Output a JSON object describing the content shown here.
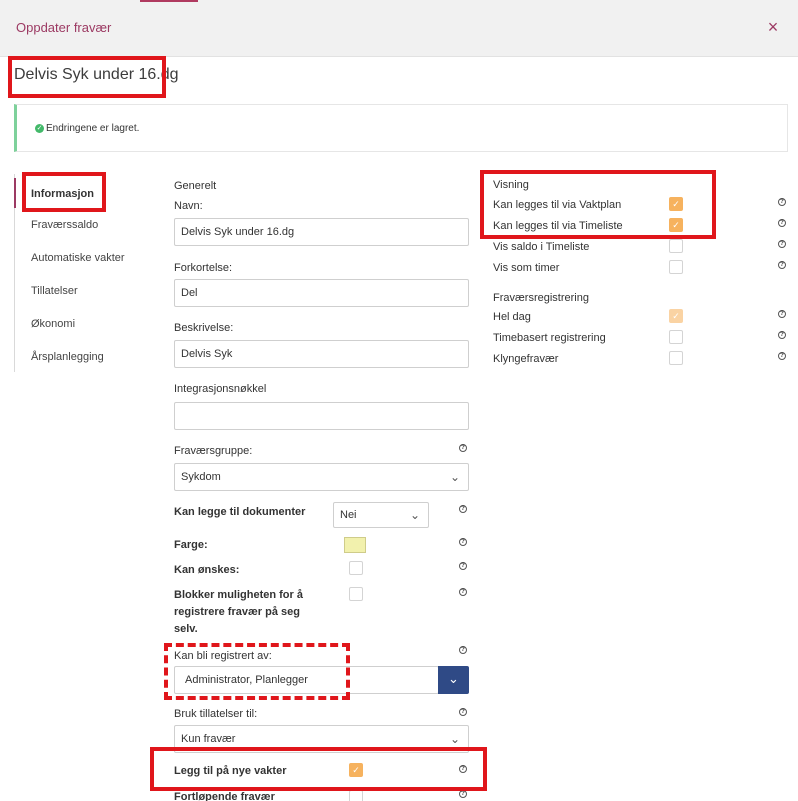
{
  "dialog": {
    "title": "Oppdater fravær",
    "close_icon": "×"
  },
  "page_title": "Delvis Syk under 16.dg",
  "alert": {
    "icon": "✓",
    "message": "Endringene er lagret."
  },
  "sidebar": {
    "items": [
      {
        "label": "Informasjon"
      },
      {
        "label": "Fraværssaldo"
      },
      {
        "label": "Automatiske vakter"
      },
      {
        "label": "Tillatelser"
      },
      {
        "label": "Økonomi"
      },
      {
        "label": "Årsplanlegging"
      }
    ]
  },
  "generelt": {
    "section": "Generelt",
    "navn_label": "Navn:",
    "navn_value": "Delvis Syk under 16.dg",
    "forkortelse_label": "Forkortelse:",
    "forkortelse_value": "Del",
    "beskrivelse_label": "Beskrivelse:",
    "beskrivelse_value": "Delvis Syk",
    "integrasjon_label": "Integrasjonsnøkkel",
    "integrasjon_value": "",
    "fravaersgruppe_label": "Fraværsgruppe:",
    "fravaersgruppe_value": "Sykdom",
    "dokumenter_label": "Kan legge til dokumenter",
    "dokumenter_value": "Nei",
    "farge_label": "Farge:",
    "farge_value": "#f2f1ad",
    "onskes_label": "Kan ønskes:",
    "blokker_label_1": "Blokker muligheten for å",
    "blokker_label_2": "registrere fravær på seg",
    "blokker_label_3": "selv.",
    "registrert_label": "Kan bli registrert av:",
    "registrert_value": "Administrator, Planlegger",
    "tillatelser_label": "Bruk tillatelser til:",
    "tillatelser_value": "Kun fravær",
    "nye_vakter_label": "Legg til på nye vakter",
    "fortlopende_label": "Fortløpende fravær"
  },
  "visning": {
    "section": "Visning",
    "items": [
      {
        "label": "Kan legges til via Vaktplan",
        "checked": true
      },
      {
        "label": "Kan legges til via Timeliste",
        "checked": true
      },
      {
        "label": "Vis saldo i Timeliste",
        "checked": false
      },
      {
        "label": "Vis som timer",
        "checked": false
      }
    ]
  },
  "registrering": {
    "section": "Fraværsregistrering",
    "items": [
      {
        "label": "Hel dag",
        "checked": true
      },
      {
        "label": "Timebasert registrering",
        "checked": false
      },
      {
        "label": "Klyngefravær",
        "checked": false
      }
    ]
  },
  "icons": {
    "help": "?",
    "chevron_down": "⌄",
    "check": "✓"
  },
  "colors": {
    "accent": "#9c3a63",
    "checkbox_on": "#f6b25e",
    "button": "#2f4a86",
    "annotation": "#e0161b"
  }
}
